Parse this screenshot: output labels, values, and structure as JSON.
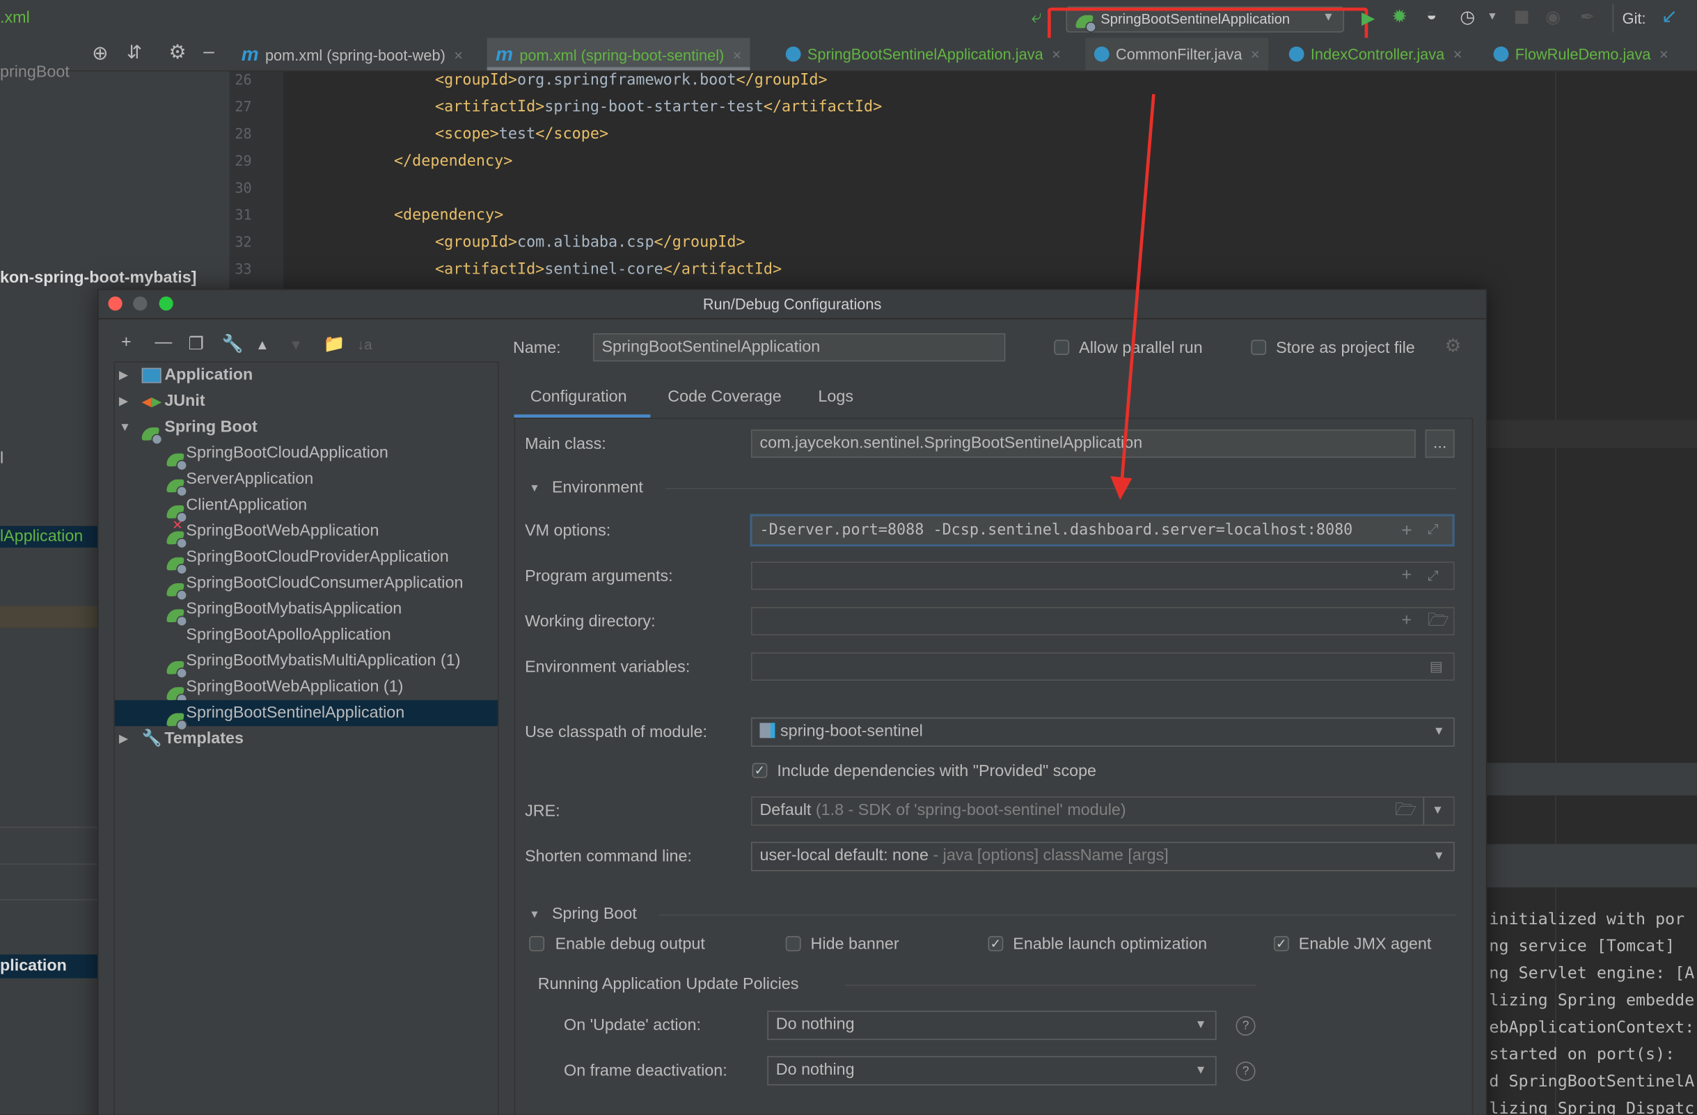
{
  "toolbar": {
    "file_title": ".xml",
    "run_config": "SpringBootSentinelApplication",
    "git_label": "Git:",
    "icons": [
      "build-hammer-icon",
      "run-icon",
      "debug-icon",
      "coverage-icon",
      "profile-icon",
      "stop-icon",
      "attach-icon",
      "git-update-icon"
    ]
  },
  "tabs": [
    {
      "label": "pom.xml (spring-boot-web)",
      "icon": "maven-icon",
      "active": false
    },
    {
      "label": "pom.xml (spring-boot-sentinel)",
      "icon": "maven-icon",
      "active": true
    },
    {
      "label": "SpringBootSentinelApplication.java",
      "icon": "spring-class-icon",
      "active": false
    },
    {
      "label": "CommonFilter.java",
      "icon": "class-icon",
      "active": false
    },
    {
      "label": "IndexController.java",
      "icon": "class-icon",
      "active": false
    },
    {
      "label": "FlowRuleDemo.java",
      "icon": "class-icon",
      "active": false
    }
  ],
  "project_panel": {
    "fragments": [
      "pringBoot",
      "kon-spring-boot-mybatis]",
      "l",
      "lApplication",
      "plication"
    ]
  },
  "editor": {
    "lines": [
      {
        "n": "26",
        "indent": 2,
        "open": "<groupId>",
        "text": "org.springframework.boot",
        "close": "</groupId>"
      },
      {
        "n": "27",
        "indent": 2,
        "open": "<artifactId>",
        "text": "spring-boot-starter-test",
        "close": "</artifactId>"
      },
      {
        "n": "28",
        "indent": 2,
        "open": "<scope>",
        "text": "test",
        "close": "</scope>"
      },
      {
        "n": "29",
        "indent": 1,
        "open": "</dependency>",
        "text": "",
        "close": ""
      },
      {
        "n": "30",
        "indent": 0,
        "open": "",
        "text": "",
        "close": ""
      },
      {
        "n": "31",
        "indent": 1,
        "open": "<dependency>",
        "text": "",
        "close": ""
      },
      {
        "n": "32",
        "indent": 2,
        "open": "<groupId>",
        "text": "com.alibaba.csp",
        "close": "</groupId>"
      },
      {
        "n": "33",
        "indent": 2,
        "open": "<artifactId>",
        "text": "sentinel-core",
        "close": "</artifactId>"
      }
    ]
  },
  "console": {
    "lines": [
      "initialized with por",
      "ng service [Tomcat]",
      "ng Servlet engine: [A",
      "lizing Spring embedde",
      "ebApplicationContext:",
      "started on port(s):",
      "d SpringBootSentinelA",
      "lizing Spring Dispatc"
    ]
  },
  "annotation": {
    "color": "#e8302a"
  },
  "dialog": {
    "title": "Run/Debug Configurations",
    "name_label": "Name:",
    "name_value": "SpringBootSentinelApplication",
    "allow_parallel_label": "Allow parallel run",
    "allow_parallel_checked": false,
    "store_project_label": "Store as project file",
    "store_project_checked": false,
    "tabs": [
      "Configuration",
      "Code Coverage",
      "Logs"
    ],
    "active_tab": "Configuration",
    "tree": {
      "groups": [
        {
          "label": "Application",
          "expanded": false
        },
        {
          "label": "JUnit",
          "expanded": false
        },
        {
          "label": "Spring Boot",
          "expanded": true
        },
        {
          "label": "Templates",
          "expanded": false
        }
      ],
      "spring_items": [
        "SpringBootCloudApplication",
        "ServerApplication",
        "ClientApplication",
        "SpringBootWebApplication",
        "SpringBootCloudProviderApplication",
        "SpringBootCloudConsumerApplication",
        "SpringBootMybatisApplication",
        "SpringBootApolloApplication",
        "SpringBootMybatisMultiApplication (1)",
        "SpringBootWebApplication (1)",
        "SpringBootSentinelApplication"
      ],
      "selected": "SpringBootSentinelApplication"
    },
    "config": {
      "main_class_label": "Main class:",
      "main_class_value": "com.jaycekon.sentinel.SpringBootSentinelApplication",
      "browse_label": "...",
      "environment_label": "Environment",
      "vm_options_label": "VM options:",
      "vm_options_value": "-Dserver.port=8088 -Dcsp.sentinel.dashboard.server=localhost:8080",
      "program_args_label": "Program arguments:",
      "working_dir_label": "Working directory:",
      "env_vars_label": "Environment variables:",
      "classpath_label": "Use classpath of module:",
      "classpath_value": "spring-boot-sentinel",
      "include_provided_label": "Include dependencies with \"Provided\" scope",
      "include_provided_checked": true,
      "jre_label": "JRE:",
      "jre_value": "Default",
      "jre_hint": "(1.8 - SDK of 'spring-boot-sentinel' module)",
      "shorten_label": "Shorten command line:",
      "shorten_value": "user-local default: none",
      "shorten_hint": "- java [options] className [args]",
      "spring_boot_label": "Spring Boot",
      "debug_output_label": "Enable debug output",
      "debug_output_checked": false,
      "hide_banner_label": "Hide banner",
      "hide_banner_checked": false,
      "launch_opt_label": "Enable launch optimization",
      "launch_opt_checked": true,
      "jmx_label": "Enable JMX agent",
      "jmx_checked": true,
      "policies_label": "Running Application Update Policies",
      "update_action_label": "On 'Update' action:",
      "update_action_value": "Do nothing",
      "frame_deact_label": "On frame deactivation:",
      "frame_deact_value": "Do nothing",
      "help": "?"
    }
  }
}
